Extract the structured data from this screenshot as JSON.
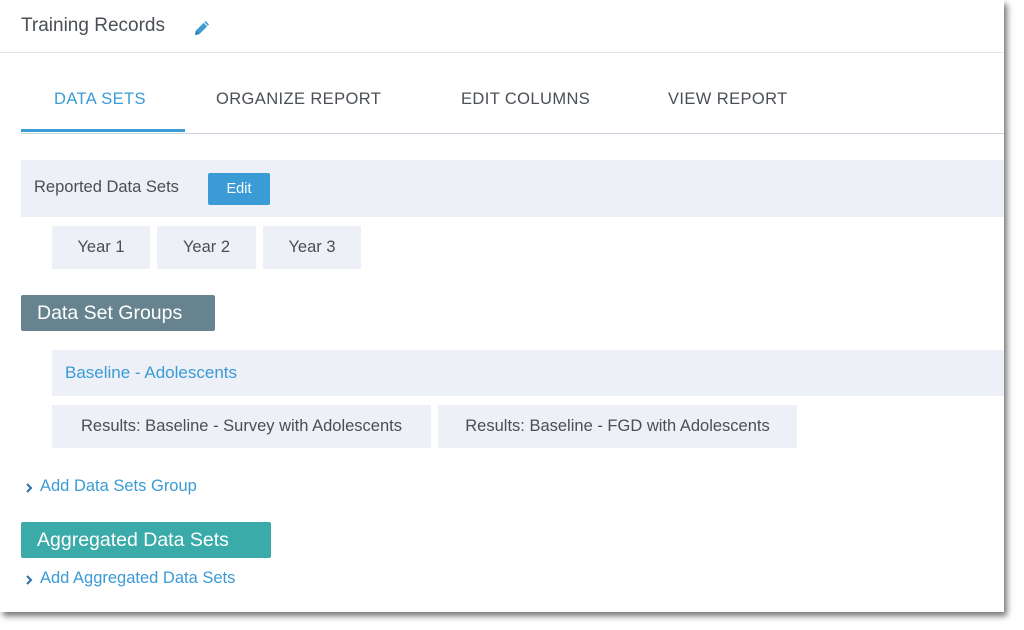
{
  "header": {
    "title": "Training Records",
    "edit_icon": "pencil-icon"
  },
  "tabs": [
    {
      "label": "DATA SETS",
      "active": true
    },
    {
      "label": "ORGANIZE REPORT",
      "active": false
    },
    {
      "label": "EDIT COLUMNS",
      "active": false
    },
    {
      "label": "VIEW REPORT",
      "active": false
    }
  ],
  "reported": {
    "label": "Reported Data Sets",
    "edit_label": "Edit",
    "items": [
      "Year 1",
      "Year 2",
      "Year 3"
    ]
  },
  "groups": {
    "heading": "Data Set Groups",
    "group_name": "Baseline - Adolescents",
    "items": [
      "Results: Baseline - Survey with Adolescents",
      "Results: Baseline - FGD with Adolescents"
    ],
    "add_label": "Add Data Sets Group"
  },
  "aggregated": {
    "heading": "Aggregated Data Sets",
    "add_label": "Add Aggregated Data Sets"
  },
  "colors": {
    "accent": "#3a9bd5",
    "groups_badge": "#66838f",
    "aggregated_badge": "#3aaba8",
    "bar_bg": "#edf0f6"
  }
}
